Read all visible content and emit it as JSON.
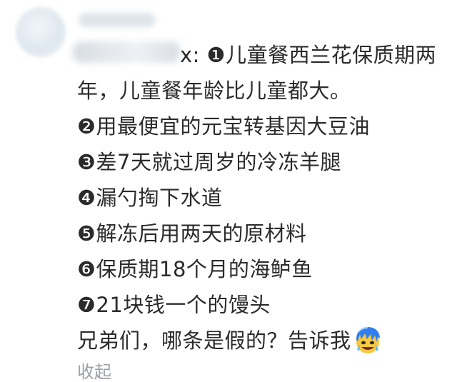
{
  "comment": {
    "lines": [
      "x: ❶儿童餐西兰花保质期两",
      "年，儿童餐年龄比儿童都大。",
      "❷用最便宜的元宝转基因大豆油",
      "❸差7天就过周岁的冷冻羊腿",
      "❹漏勺掏下水道",
      "❺解冻后用两天的原材料",
      "❻保质期18个月的海鲈鱼",
      "❼21块钱一个的馒头"
    ],
    "ask": "兄弟们，哪条是假的？告诉我",
    "emoji": "crying-laughing-emoji"
  },
  "actions": {
    "collapse_label": "收起"
  }
}
